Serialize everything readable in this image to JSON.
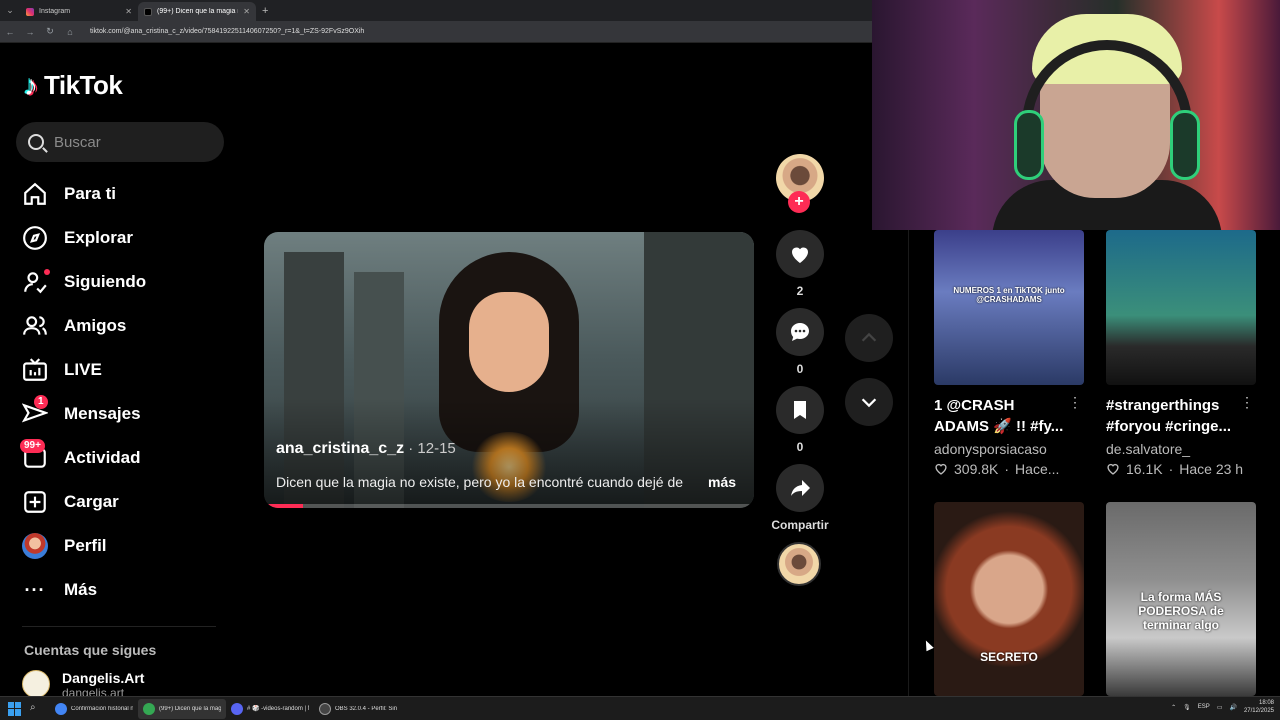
{
  "browser": {
    "tabs": [
      {
        "title": "Instagram",
        "active": false
      },
      {
        "title": "(99+) Dicen que la magia n",
        "active": true
      }
    ],
    "url": "tiktok.com/@ana_cristina_c_z/video/7584192251140607250?_r=1&_t=ZS-92FvSz9OXih"
  },
  "sidebar": {
    "logo": "TikTok",
    "search_placeholder": "Buscar",
    "items": [
      {
        "label": "Para ti",
        "icon": "home-icon"
      },
      {
        "label": "Explorar",
        "icon": "compass-icon"
      },
      {
        "label": "Siguiendo",
        "icon": "following-icon"
      },
      {
        "label": "Amigos",
        "icon": "friends-icon"
      },
      {
        "label": "LIVE",
        "icon": "live-icon"
      },
      {
        "label": "Mensajes",
        "icon": "messages-icon",
        "badge": "1"
      },
      {
        "label": "Actividad",
        "icon": "activity-icon",
        "badge": "99+"
      },
      {
        "label": "Cargar",
        "icon": "upload-icon"
      },
      {
        "label": "Perfil",
        "icon": "profile-avatar"
      },
      {
        "label": "Más",
        "icon": "more-icon"
      }
    ],
    "following_title": "Cuentas que sigues",
    "following": [
      {
        "name": "Dangelis.Art",
        "handle": "dangelis.art"
      }
    ]
  },
  "video": {
    "username": "ana_cristina_c_z",
    "date": " · 12-15",
    "caption": "Dicen que la magia no existe, pero yo la encontré cuando dejé de",
    "more": "más",
    "progress": 0.08
  },
  "actions": {
    "likes": "2",
    "comments": "0",
    "saves": "0",
    "share_label": "Compartir"
  },
  "recommended": [
    {
      "title": "1 @CRASH ADAMS 🚀 !! #fy...",
      "author": "adonysporsiacaso",
      "likes": "309.8K",
      "time": "Hace...",
      "thumb_text": "NUMEROS 1 en TikTOK junto @CRASHADAMS"
    },
    {
      "title": "#strangerthings #foryou #cringe...",
      "author": "de.salvatore_",
      "likes": "16.1K",
      "time": "Hace 23 h",
      "thumb_text": ""
    },
    {
      "title": "",
      "author": "",
      "likes": "",
      "time": "",
      "thumb_text": "SECRETO"
    },
    {
      "title": "",
      "author": "",
      "likes": "",
      "time": "",
      "thumb_text": "La forma MÁS PODEROSA de terminar algo"
    }
  ],
  "taskbar": {
    "apps": [
      {
        "label": "Confirmación historial n",
        "color": "#4285f4"
      },
      {
        "label": "(99+) Dicen que la magi",
        "color": "#34a853"
      },
      {
        "label": "# 🎲 -videos-random | M",
        "color": "#5865f2"
      },
      {
        "label": "OBS 32.0.4 - Perfil: Sin T",
        "color": "#444444"
      }
    ],
    "lang": "ESP",
    "time": "18:08",
    "date": "27/12/2025"
  }
}
